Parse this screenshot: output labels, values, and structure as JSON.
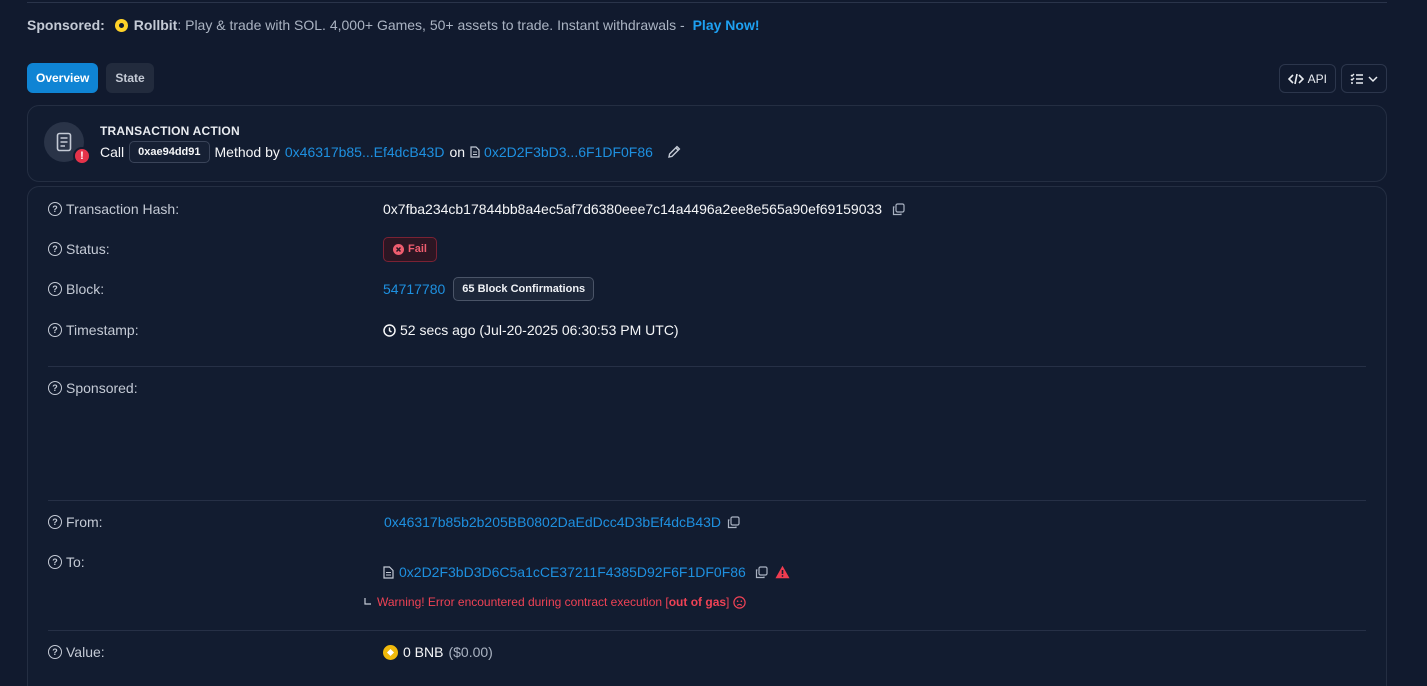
{
  "sponsor": {
    "label": "Sponsored:",
    "brand": "Rollbit",
    "text": ": Play & trade with SOL. 4,000+ Games, 50+ assets to trade. Instant withdrawals - ",
    "cta": "Play Now!"
  },
  "tabs": [
    {
      "label": "Overview",
      "active": true
    },
    {
      "label": "State",
      "active": false
    }
  ],
  "toolbar": {
    "api_label": "API"
  },
  "action": {
    "title": "TRANSACTION ACTION",
    "call": "Call",
    "method_id": "0xae94dd91",
    "method_by": "Method by",
    "from_short": "0x46317b85...Ef4dcB43D",
    "on": "on",
    "to_short": "0x2D2F3bD3...6F1DF0F86"
  },
  "details": {
    "tx_hash": {
      "label": "Transaction Hash:",
      "value": "0x7fba234cb17844bb8a4ec5af7d6380eee7c14a4496a2ee8e565a90ef69159033"
    },
    "status": {
      "label": "Status:",
      "value": "Fail"
    },
    "block": {
      "label": "Block:",
      "number": "54717780",
      "confirmations": "65 Block Confirmations"
    },
    "timestamp": {
      "label": "Timestamp:",
      "value": "52 secs ago (Jul-20-2025 06:30:53 PM UTC)"
    },
    "sponsored": {
      "label": "Sponsored:"
    },
    "from": {
      "label": "From:",
      "value": "0x46317b85b2b205BB0802DaEdDcc4D3bEf4dcB43D"
    },
    "to": {
      "label": "To:",
      "value": "0x2D2F3bD3D6C5a1cCE37211F4385D92F6F1DF0F86",
      "warning_prefix": "Warning! Error encountered during contract execution [",
      "warning_bold": "out of gas",
      "warning_suffix": "]"
    },
    "value": {
      "label": "Value:",
      "amount": "0 BNB",
      "usd": "($0.00)"
    }
  }
}
